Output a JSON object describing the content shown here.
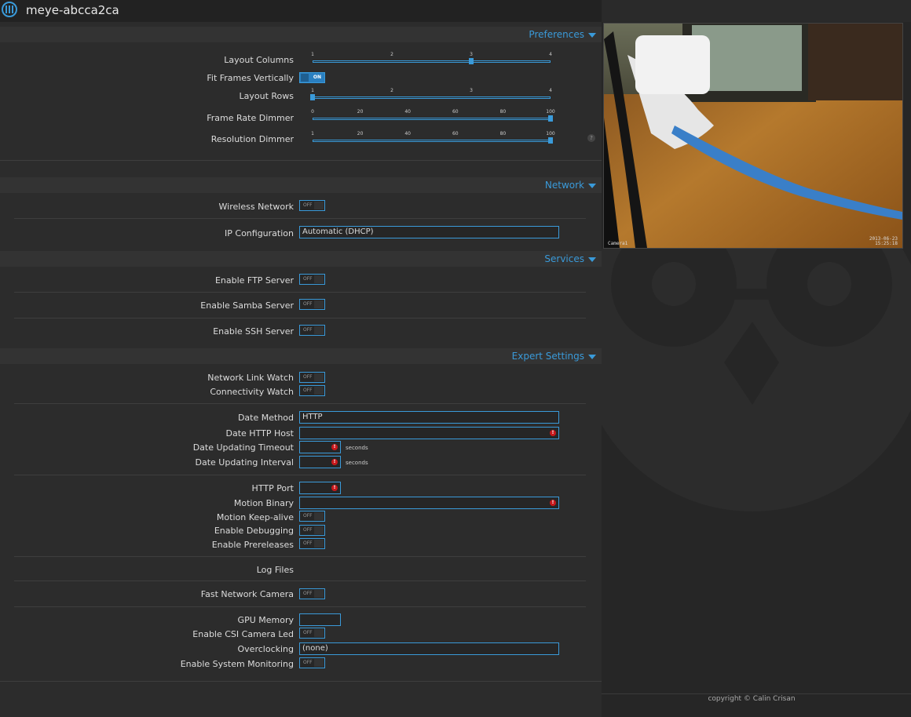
{
  "header": {
    "title": "meye-abcca2ca"
  },
  "sections": {
    "preferences": "Preferences",
    "network": "Network",
    "services": "Services",
    "expert": "Expert Settings"
  },
  "preferences": {
    "layout_columns": {
      "label": "Layout Columns",
      "ticks": [
        "1",
        "2",
        "3",
        "4"
      ],
      "value": 3
    },
    "fit_frames": {
      "label": "Fit Frames Vertically",
      "state": "ON"
    },
    "layout_rows": {
      "label": "Layout Rows",
      "ticks": [
        "1",
        "2",
        "3",
        "4"
      ],
      "value": 1
    },
    "frame_rate_dimmer": {
      "label": "Frame Rate Dimmer",
      "ticks": [
        "0",
        "20",
        "40",
        "60",
        "80",
        "100"
      ],
      "value": 100
    },
    "resolution_dimmer": {
      "label": "Resolution Dimmer",
      "ticks": [
        "1",
        "20",
        "40",
        "60",
        "80",
        "100"
      ],
      "value": 100
    },
    "help": "?"
  },
  "network": {
    "wireless": {
      "label": "Wireless Network",
      "state": "OFF"
    },
    "ip_config": {
      "label": "IP Configuration",
      "value": "Automatic (DHCP)"
    }
  },
  "services": {
    "ftp": {
      "label": "Enable FTP Server",
      "state": "OFF"
    },
    "samba": {
      "label": "Enable Samba Server",
      "state": "OFF"
    },
    "ssh": {
      "label": "Enable SSH Server",
      "state": "OFF"
    }
  },
  "expert": {
    "link_watch": {
      "label": "Network Link Watch",
      "state": "OFF"
    },
    "conn_watch": {
      "label": "Connectivity Watch",
      "state": "OFF"
    },
    "date_method": {
      "label": "Date Method",
      "value": "HTTP"
    },
    "date_host": {
      "label": "Date HTTP Host",
      "value": ""
    },
    "date_timeout": {
      "label": "Date Updating Timeout",
      "value": "",
      "unit": "seconds"
    },
    "date_interval": {
      "label": "Date Updating Interval",
      "value": "",
      "unit": "seconds"
    },
    "http_port": {
      "label": "HTTP Port",
      "value": ""
    },
    "motion_binary": {
      "label": "Motion Binary",
      "value": ""
    },
    "keep_alive": {
      "label": "Motion Keep-alive",
      "state": "OFF"
    },
    "debugging": {
      "label": "Enable Debugging",
      "state": "OFF"
    },
    "prereleases": {
      "label": "Enable Prereleases",
      "state": "OFF"
    },
    "log_files": {
      "label": "Log Files"
    },
    "fast_camera": {
      "label": "Fast Network Camera",
      "state": "OFF"
    },
    "gpu_memory": {
      "label": "GPU Memory",
      "value": ""
    },
    "csi_led": {
      "label": "Enable CSI Camera Led",
      "state": "OFF"
    },
    "overclocking": {
      "label": "Overclocking",
      "value": "(none)"
    },
    "sys_monitor": {
      "label": "Enable System Monitoring",
      "state": "OFF"
    }
  },
  "error_mark": "!",
  "camera": {
    "name": "Camera1",
    "date": "2013-06-23",
    "time": "15:25:18"
  },
  "footer": {
    "copyright": "copyright © Calin Crisan"
  },
  "colors": {
    "accent": "#3a9ad9",
    "error": "#c8171b",
    "background": "#2c2c2c"
  }
}
